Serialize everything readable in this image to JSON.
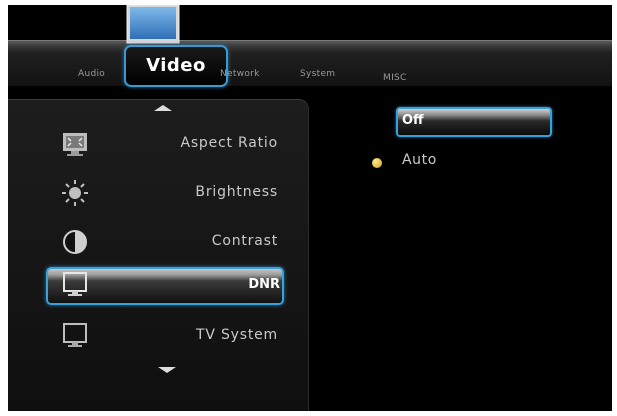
{
  "tabs": [
    {
      "label": "Audio"
    },
    {
      "label": "Video",
      "active": true
    },
    {
      "label": "Network"
    },
    {
      "label": "System"
    },
    {
      "label": "MISC"
    }
  ],
  "menu": [
    {
      "label": "Aspect Ratio",
      "icon": "aspect-ratio-icon"
    },
    {
      "label": "Brightness",
      "icon": "brightness-icon"
    },
    {
      "label": "Contrast",
      "icon": "contrast-icon"
    },
    {
      "label": "DNR",
      "icon": "tv-icon",
      "selected": true
    },
    {
      "label": "TV System",
      "icon": "tv-icon"
    }
  ],
  "options": [
    {
      "label": "Off",
      "highlighted": true
    },
    {
      "label": "Auto",
      "current": true
    }
  ],
  "colors": {
    "highlight_border": "#3aa0d8",
    "selected_dot": "#e0b22a",
    "background": "#000000"
  }
}
